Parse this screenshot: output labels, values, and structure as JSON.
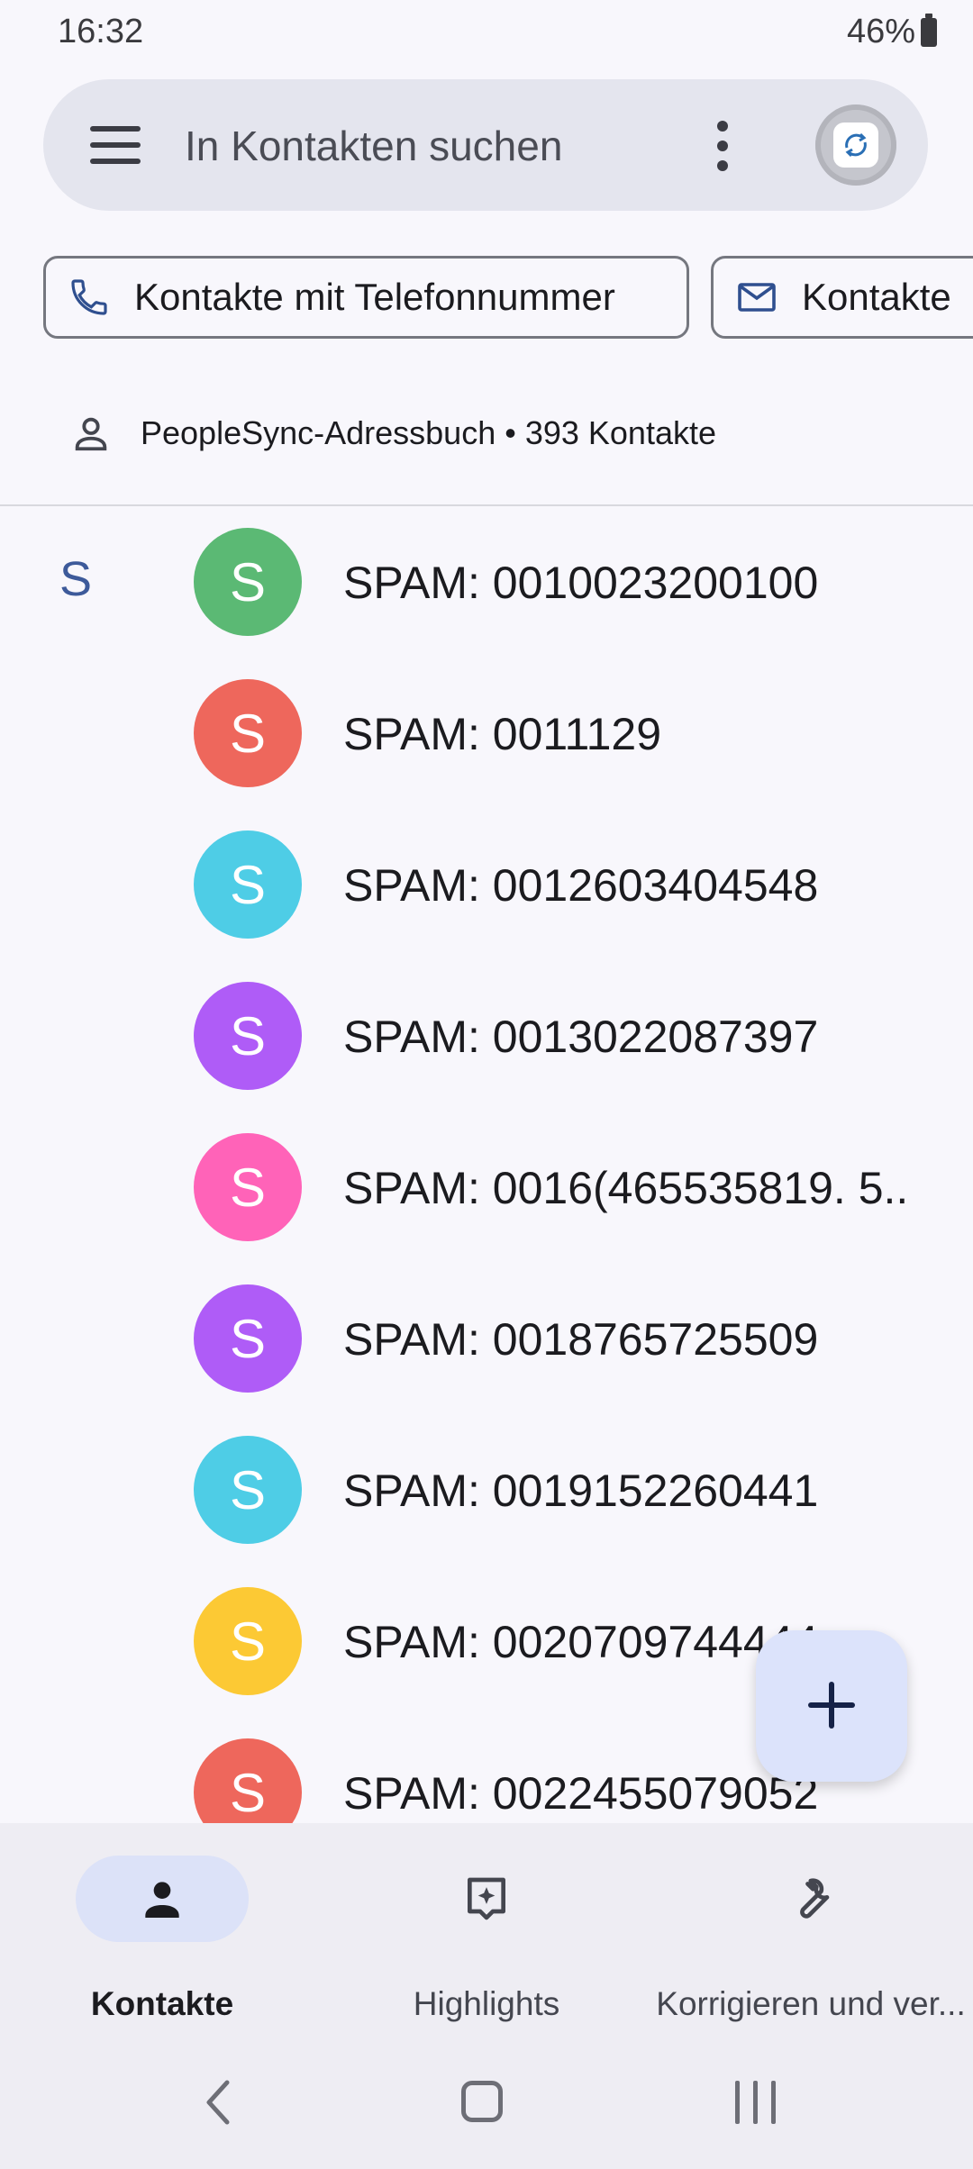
{
  "status_bar": {
    "time": "16:32",
    "battery": "46%"
  },
  "search": {
    "placeholder": "In Kontakten suchen"
  },
  "chips": [
    {
      "label": "Kontakte mit Telefonnummer",
      "icon": "phone-icon"
    },
    {
      "label": "Kontakte",
      "icon": "mail-icon"
    }
  ],
  "address_book": {
    "text": "PeopleSync-Adressbuch • 393 Kontakte"
  },
  "section_letter": "S",
  "contacts": [
    {
      "initial": "S",
      "name": "SPAM: 0010023200100",
      "color": "#5bb974"
    },
    {
      "initial": "S",
      "name": "SPAM: 0011129",
      "color": "#ee675c"
    },
    {
      "initial": "S",
      "name": "SPAM: 0012603404548",
      "color": "#4ecde6"
    },
    {
      "initial": "S",
      "name": "SPAM: 0013022087397",
      "color": "#af5cf7"
    },
    {
      "initial": "S",
      "name": "SPAM: 0016(465535819. 5..",
      "color": "#ff63b8"
    },
    {
      "initial": "S",
      "name": "SPAM: 0018765725509",
      "color": "#af5cf7"
    },
    {
      "initial": "S",
      "name": "SPAM: 0019152260441",
      "color": "#4ecde6"
    },
    {
      "initial": "S",
      "name": "SPAM: 0020709744444",
      "color": "#fcc934"
    },
    {
      "initial": "S",
      "name": "SPAM: 0022455079052",
      "color": "#ee675c"
    }
  ],
  "bottom_nav": [
    {
      "label": "Kontakte",
      "active": true
    },
    {
      "label": "Highlights",
      "active": false
    },
    {
      "label": "Korrigieren und ver...",
      "active": false
    }
  ]
}
